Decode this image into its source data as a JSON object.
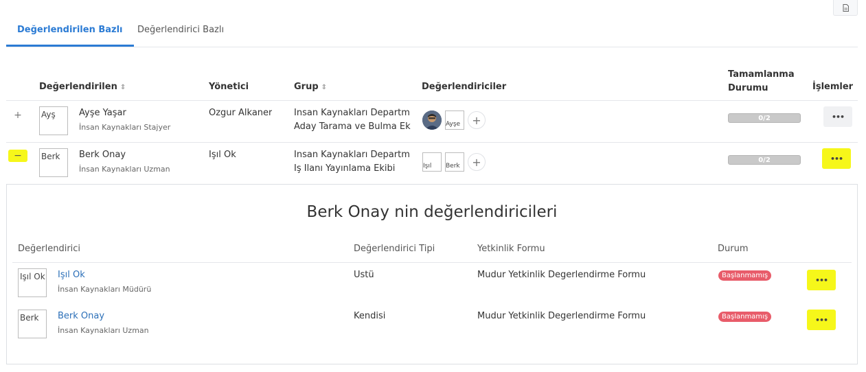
{
  "tabs": [
    {
      "label": "Değerlendirilen Bazlı",
      "active": true
    },
    {
      "label": "Değerlendirici Bazlı",
      "active": false
    }
  ],
  "table": {
    "headers": {
      "evaluated": "Değerlendirilen",
      "manager": "Yönetici",
      "group": "Grup",
      "evaluators": "Değerlendiriciler",
      "completion": "Tamamlanma Durumu",
      "actions": "İşlemler"
    },
    "rows": [
      {
        "toggle": "+",
        "avatar_alt": "Ayş",
        "name": "Ayşe Yaşar",
        "title": "İnsan Kaynakları Stajyer",
        "manager": "Özgur Alkaner",
        "group_line1": "İnsan Kaynakları Departm",
        "group_line2": "Aday Tarama ve Bulma Ek",
        "evaluator2_alt": "Ayşe",
        "progress": "0/2",
        "actions": "•••"
      },
      {
        "toggle": "−",
        "avatar_alt": "Berk",
        "name": "Berk Onay",
        "title": "İnsan Kaynakları Uzman",
        "manager": "Işıl Ok",
        "group_line1": "İnsan Kaynakları Departm",
        "group_line2": "İş İlanı Yayınlama Ekibi",
        "evaluator1_alt": "Işıl",
        "evaluator2_alt": "Berk",
        "progress": "0/2",
        "actions": "•••"
      }
    ]
  },
  "detail": {
    "title": "Berk Onay nin değerlendiricileri",
    "headers": {
      "evaluator": "Değerlendirici",
      "type": "Değerlendirici Tipi",
      "form": "Yetkinlik Formu",
      "status": "Durum"
    },
    "rows": [
      {
        "avatar_alt": "Işıl Ok",
        "name": "Işıl Ok",
        "title": "İnsan Kaynakları Müdürü",
        "type": "Üstü",
        "form": "Mudur Yetkinlik Degerlendirme Formu",
        "status": "Başlanmamış",
        "actions": "•••"
      },
      {
        "avatar_alt": "Berk",
        "name": "Berk Onay",
        "title": "İnsan Kaynakları Uzman",
        "type": "Kendisi",
        "form": "Mudur Yetkinlik Degerlendirme Formu",
        "status": "Başlanmamış",
        "actions": "•••"
      }
    ]
  },
  "colors": {
    "accent": "#2b7bd4",
    "highlight": "#f6f71a",
    "badge": "#e85c6a"
  }
}
